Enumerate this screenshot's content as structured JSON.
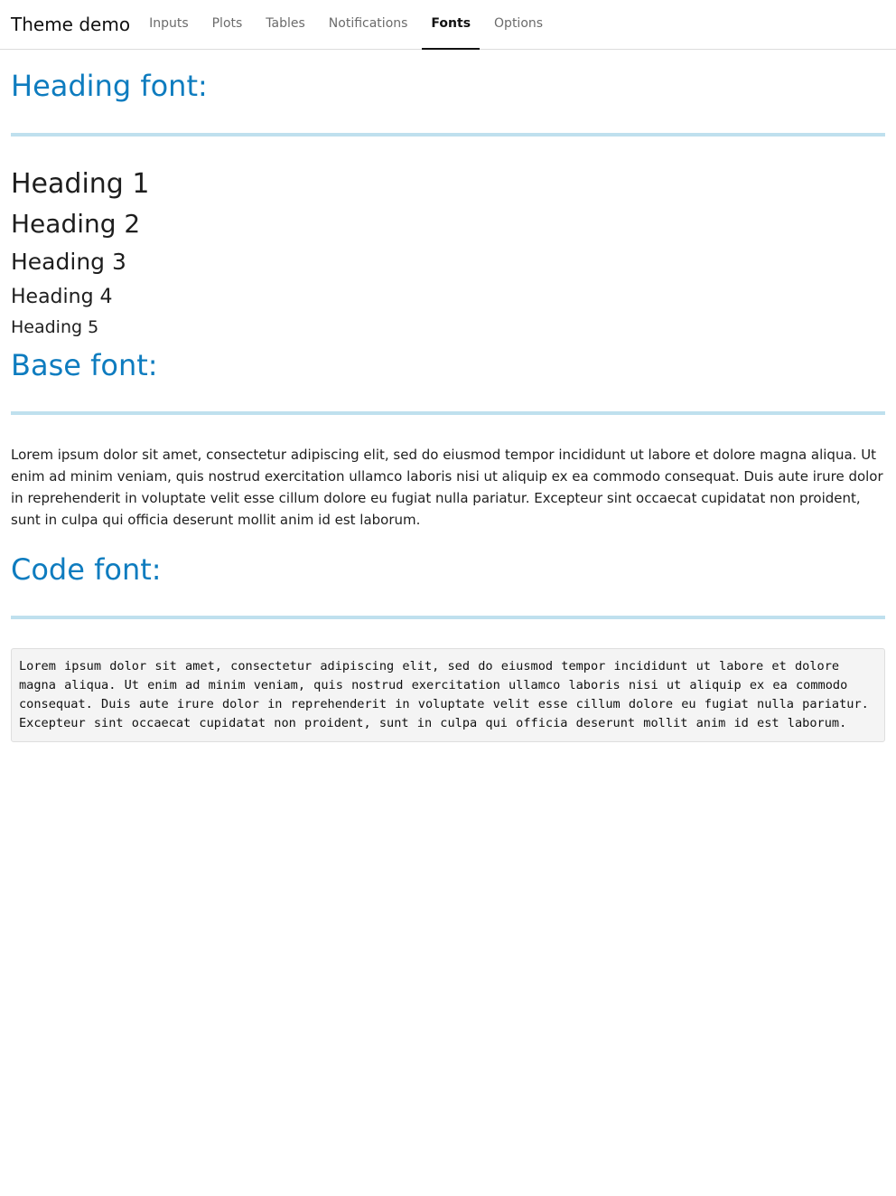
{
  "app": {
    "brand": "Theme demo"
  },
  "nav": {
    "tabs": [
      {
        "label": "Inputs",
        "active": false
      },
      {
        "label": "Plots",
        "active": false
      },
      {
        "label": "Tables",
        "active": false
      },
      {
        "label": "Notifications",
        "active": false
      },
      {
        "label": "Fonts",
        "active": true
      },
      {
        "label": "Options",
        "active": false
      }
    ]
  },
  "fonts_page": {
    "heading_section_title": "Heading font:",
    "headings": [
      "Heading 1",
      "Heading 2",
      "Heading 3",
      "Heading 4",
      "Heading 5"
    ],
    "base_section_title": "Base font:",
    "base_text": "Lorem ipsum dolor sit amet, consectetur adipiscing elit, sed do eiusmod tempor incididunt ut labore et dolore magna aliqua. Ut enim ad minim veniam, quis nostrud exercitation ullamco laboris nisi ut aliquip ex ea commodo consequat. Duis aute irure dolor in reprehenderit in voluptate velit esse cillum dolore eu fugiat nulla pariatur. Excepteur sint occaecat cupidatat non proident, sunt in culpa qui officia deserunt mollit anim id est laborum.",
    "code_section_title": "Code font:",
    "code_text": "Lorem ipsum dolor sit amet, consectetur adipiscing elit, sed do eiusmod tempor incididunt ut labore et dolore magna aliqua. Ut enim ad minim veniam, quis nostrud exercitation ullamco laboris nisi ut aliquip ex ea commodo consequat. Duis aute irure dolor in reprehenderit in voluptate velit esse cillum dolore eu fugiat nulla pariatur. Excepteur sint occaecat cupidatat non proident, sunt in culpa qui officia deserunt mollit anim id est laborum."
  },
  "colors": {
    "accent": "#0e7cbf",
    "rule": "#bfe0ee",
    "code_background": "#f4f4f4"
  }
}
